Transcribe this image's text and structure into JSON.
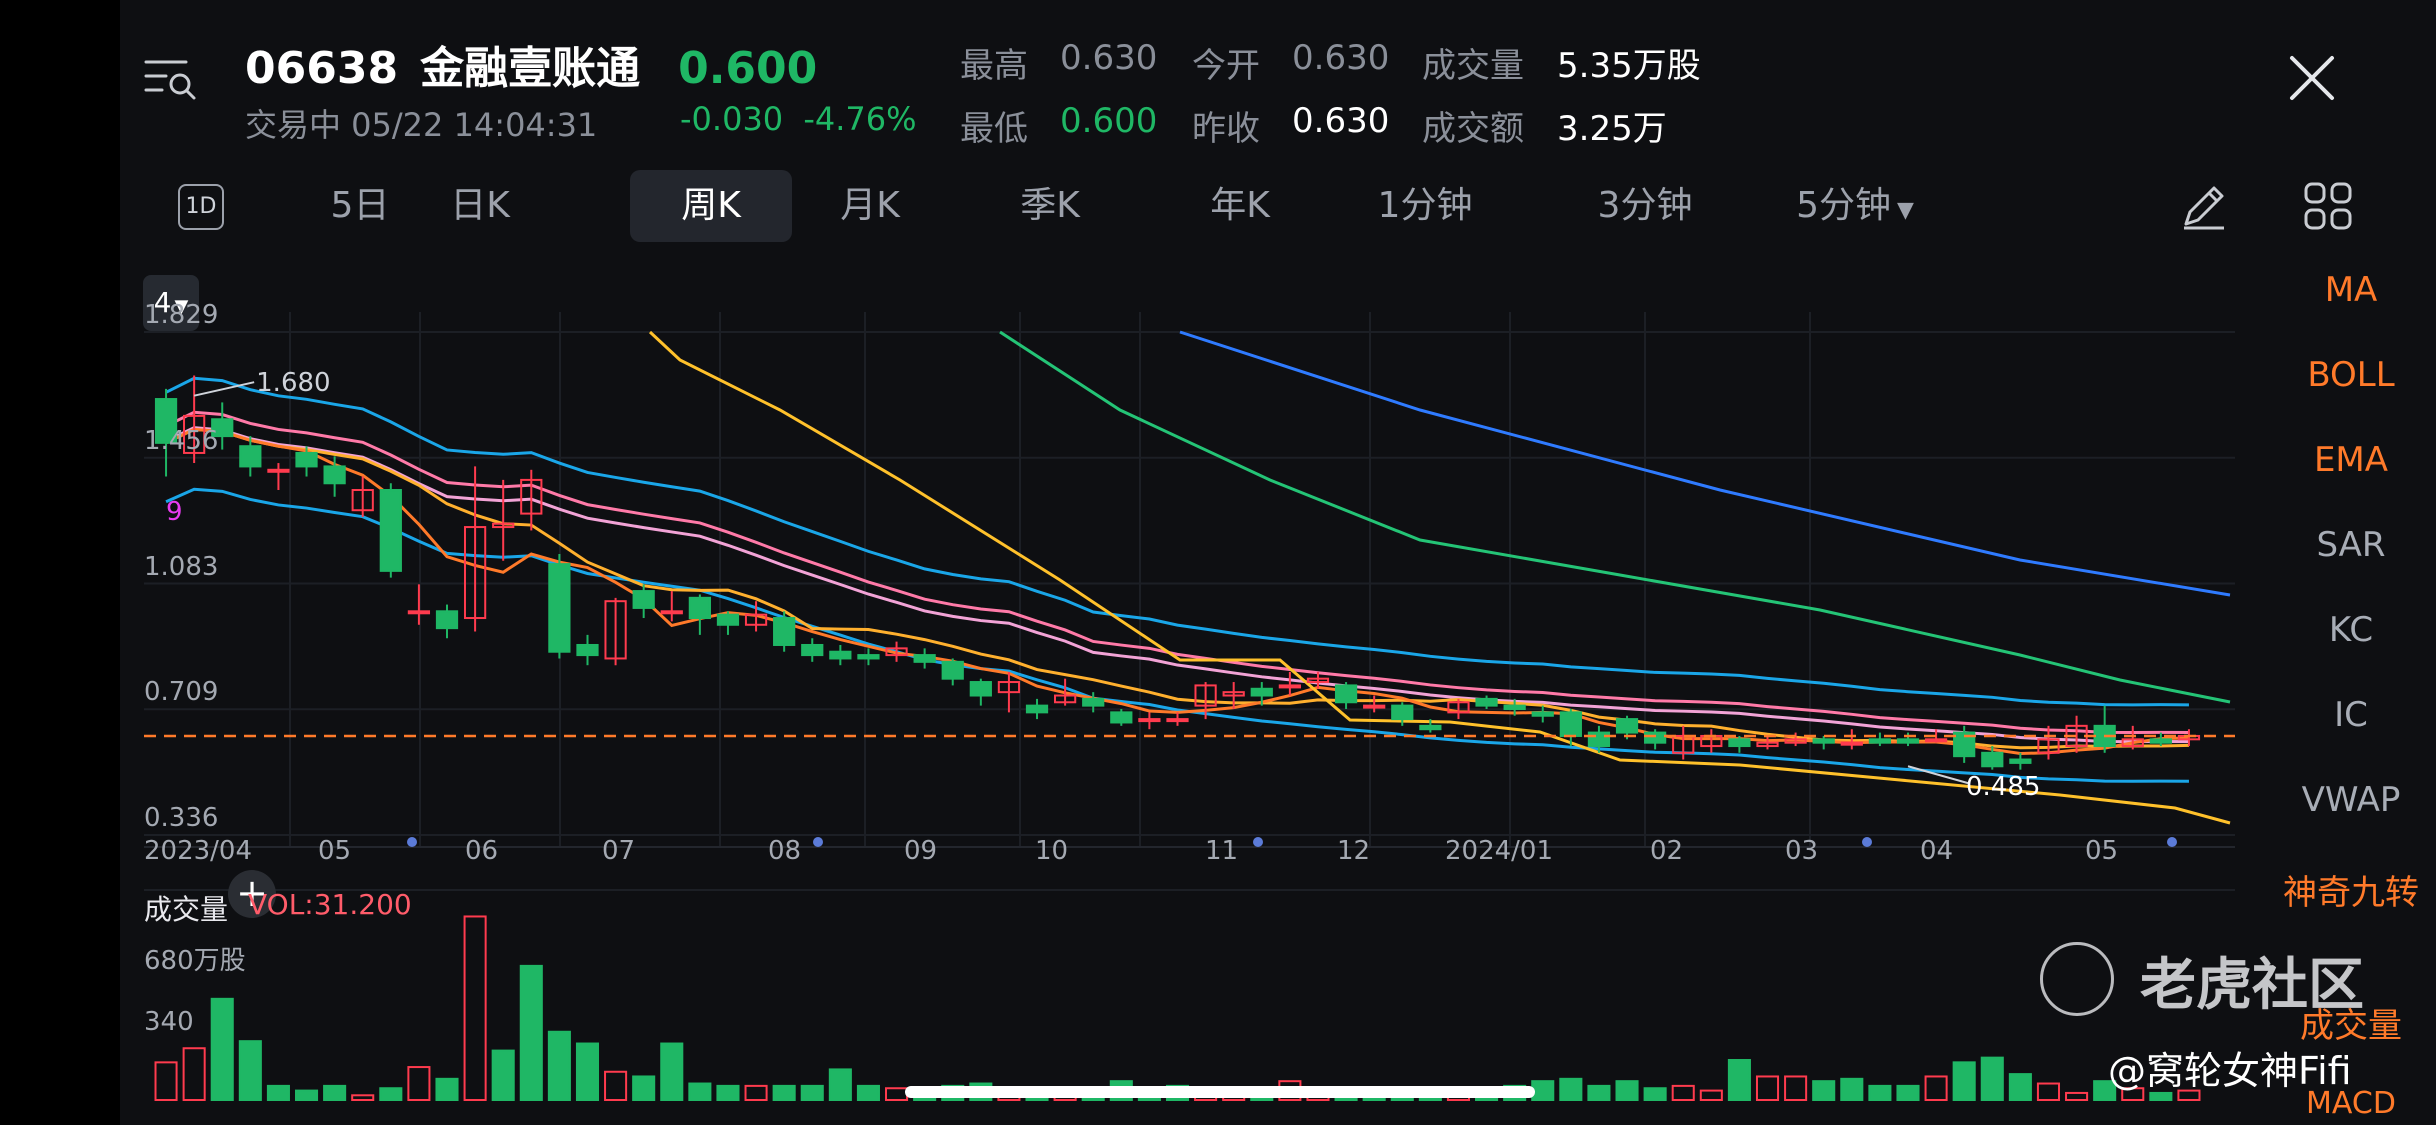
{
  "header": {
    "symbol": "06638",
    "name": "金融壹账通",
    "price": "0.600",
    "status": "交易中 05/22 14:04:31",
    "change": "-0.030",
    "change_pct": "-4.76%",
    "stats": {
      "high_label": "最高",
      "high": "0.630",
      "open_label": "今开",
      "open": "0.630",
      "volume_label": "成交量",
      "volume": "5.35万股",
      "low_label": "最低",
      "low": "0.600",
      "prev_close_label": "昨收",
      "prev_close": "0.630",
      "turnover_label": "成交额",
      "turnover": "3.25万"
    }
  },
  "tabs": {
    "d1": "1D",
    "items": [
      "5日",
      "日K",
      "周K",
      "月K",
      "季K",
      "年K",
      "1分钟",
      "3分钟",
      "5分钟"
    ],
    "active": "周K"
  },
  "indicators": [
    "MA",
    "BOLL",
    "EMA",
    "SAR",
    "KC",
    "IC",
    "VWAP",
    "神奇九转",
    "成交量",
    "MACD"
  ],
  "chart": {
    "ma_selector": "4",
    "y_ticks": [
      "1.829",
      "1.456",
      "1.083",
      "0.709",
      "0.336"
    ],
    "x_ticks": [
      "2023/04",
      "05",
      "06",
      "07",
      "08",
      "09",
      "10",
      "11",
      "12",
      "2024/01",
      "02",
      "03",
      "04",
      "05"
    ],
    "max_label": "1.680",
    "min_label": "0.485",
    "nine_label": "9",
    "last_price_line": 0.63
  },
  "volume": {
    "title": "成交量",
    "value": "VOL:31.200",
    "y_ticks": [
      "680万股",
      "340"
    ]
  },
  "colors": {
    "up": "#ff3b4e",
    "down": "#1fb765",
    "accent": "#ff7a2a"
  },
  "watermark": "老虎社区",
  "author": "@窝轮女神Fifi",
  "chart_data": {
    "type": "candlestick",
    "x": [
      "2023/04",
      "",
      "",
      "",
      "",
      "05",
      "",
      "",
      "",
      "06",
      "",
      "",
      "",
      "",
      "07",
      "",
      "",
      "",
      "08",
      "",
      "",
      "",
      "",
      "09",
      "",
      "",
      "",
      "10",
      "",
      "",
      "",
      "",
      "11",
      "",
      "",
      "",
      "12",
      "",
      "",
      "",
      "2024/01",
      "",
      "",
      "",
      "",
      "02",
      "",
      "",
      "",
      "03",
      "",
      "",
      "",
      "",
      "04",
      "",
      "",
      "",
      "05",
      "",
      "",
      ""
    ],
    "series": [
      {
        "name": "",
        "values": []
      }
    ],
    "candles": [
      [
        1.63,
        1.5,
        1.66,
        1.4
      ],
      [
        1.47,
        1.58,
        1.7,
        1.44
      ],
      [
        1.57,
        1.52,
        1.62,
        1.48
      ],
      [
        1.49,
        1.43,
        1.52,
        1.4
      ],
      [
        1.42,
        1.42,
        1.44,
        1.36
      ],
      [
        1.47,
        1.43,
        1.49,
        1.4
      ],
      [
        1.43,
        1.38,
        1.46,
        1.34
      ],
      [
        1.3,
        1.36,
        1.4,
        1.28
      ],
      [
        1.36,
        1.12,
        1.38,
        1.1
      ],
      [
        1.0,
        1.0,
        1.08,
        0.96
      ],
      [
        1.0,
        0.95,
        1.02,
        0.92
      ],
      [
        0.98,
        1.25,
        1.43,
        0.94
      ],
      [
        1.25,
        1.26,
        1.39,
        1.15
      ],
      [
        1.29,
        1.39,
        1.42,
        1.24
      ],
      [
        1.14,
        0.88,
        1.17,
        0.86
      ],
      [
        0.9,
        0.87,
        0.93,
        0.84
      ],
      [
        0.86,
        1.03,
        1.04,
        0.84
      ],
      [
        1.06,
        1.01,
        1.08,
        0.98
      ],
      [
        1.0,
        1.0,
        1.06,
        0.97
      ],
      [
        1.04,
        0.98,
        1.05,
        0.93
      ],
      [
        0.99,
        0.96,
        1.0,
        0.93
      ],
      [
        0.96,
        0.99,
        1.03,
        0.94
      ],
      [
        0.98,
        0.9,
        1.0,
        0.88
      ],
      [
        0.9,
        0.87,
        0.92,
        0.85
      ],
      [
        0.88,
        0.86,
        0.9,
        0.84
      ],
      [
        0.87,
        0.86,
        0.89,
        0.84
      ],
      [
        0.87,
        0.89,
        0.91,
        0.85
      ],
      [
        0.87,
        0.85,
        0.89,
        0.83
      ],
      [
        0.85,
        0.8,
        0.86,
        0.78
      ],
      [
        0.79,
        0.75,
        0.8,
        0.72
      ],
      [
        0.76,
        0.79,
        0.82,
        0.7
      ],
      [
        0.72,
        0.7,
        0.74,
        0.68
      ],
      [
        0.73,
        0.75,
        0.8,
        0.72
      ],
      [
        0.74,
        0.72,
        0.76,
        0.7
      ],
      [
        0.7,
        0.67,
        0.71,
        0.66
      ],
      [
        0.68,
        0.68,
        0.7,
        0.65
      ],
      [
        0.68,
        0.68,
        0.7,
        0.66
      ],
      [
        0.72,
        0.78,
        0.79,
        0.68
      ],
      [
        0.75,
        0.76,
        0.79,
        0.71
      ],
      [
        0.77,
        0.75,
        0.79,
        0.72
      ],
      [
        0.78,
        0.78,
        0.82,
        0.75
      ],
      [
        0.79,
        0.8,
        0.82,
        0.77
      ],
      [
        0.78,
        0.73,
        0.79,
        0.71
      ],
      [
        0.72,
        0.72,
        0.75,
        0.7
      ],
      [
        0.72,
        0.68,
        0.73,
        0.66
      ],
      [
        0.66,
        0.65,
        0.68,
        0.64
      ],
      [
        0.7,
        0.73,
        0.74,
        0.68
      ],
      [
        0.74,
        0.72,
        0.75,
        0.71
      ],
      [
        0.72,
        0.71,
        0.74,
        0.69
      ],
      [
        0.7,
        0.69,
        0.72,
        0.67
      ],
      [
        0.7,
        0.63,
        0.71,
        0.6
      ],
      [
        0.64,
        0.6,
        0.66,
        0.58
      ],
      [
        0.68,
        0.64,
        0.69,
        0.62
      ],
      [
        0.64,
        0.61,
        0.65,
        0.59
      ],
      [
        0.58,
        0.63,
        0.66,
        0.56
      ],
      [
        0.6,
        0.63,
        0.65,
        0.58
      ],
      [
        0.62,
        0.6,
        0.63,
        0.58
      ],
      [
        0.6,
        0.61,
        0.63,
        0.59
      ],
      [
        0.61,
        0.62,
        0.64,
        0.6
      ],
      [
        0.62,
        0.61,
        0.63,
        0.59
      ],
      [
        0.61,
        0.61,
        0.65,
        0.59
      ],
      [
        0.62,
        0.61,
        0.64,
        0.6
      ],
      [
        0.62,
        0.61,
        0.64,
        0.6
      ],
      [
        0.62,
        0.62,
        0.65,
        0.61
      ],
      [
        0.64,
        0.57,
        0.66,
        0.55
      ],
      [
        0.58,
        0.54,
        0.6,
        0.53
      ],
      [
        0.56,
        0.55,
        0.58,
        0.53
      ],
      [
        0.58,
        0.62,
        0.66,
        0.56
      ],
      [
        0.6,
        0.66,
        0.69,
        0.58
      ],
      [
        0.66,
        0.6,
        0.72,
        0.58
      ],
      [
        0.6,
        0.62,
        0.66,
        0.59
      ],
      [
        0.62,
        0.61,
        0.64,
        0.6
      ],
      [
        0.62,
        0.63,
        0.65,
        0.6
      ]
    ],
    "volumes": [
      1.6,
      2.2,
      4.3,
      2.5,
      0.6,
      0.4,
      0.6,
      0.2,
      0.5,
      1.4,
      0.9,
      7.8,
      2.1,
      5.7,
      2.9,
      2.4,
      1.2,
      1.0,
      2.4,
      0.7,
      0.6,
      0.6,
      0.6,
      0.6,
      1.3,
      0.6,
      0.5,
      0.4,
      0.6,
      0.7,
      0.5,
      0.4,
      0.5,
      0.5,
      0.8,
      0.4,
      0.6,
      0.5,
      0.5,
      0.5,
      0.8,
      0.4,
      0.5,
      0.5,
      0.4,
      0.5,
      0.4,
      0.4,
      0.6,
      0.8,
      0.9,
      0.6,
      0.8,
      0.5,
      0.6,
      0.4,
      1.7,
      1.0,
      1.0,
      0.8,
      0.9,
      0.6,
      0.6,
      1.0,
      1.6,
      1.8,
      1.1,
      0.7,
      0.3,
      0.8,
      0.5,
      0.3,
      0.4
    ],
    "volume_up": [
      true,
      true,
      false,
      false,
      false,
      false,
      false,
      true,
      false,
      true,
      false,
      true,
      false,
      false,
      false,
      false,
      true,
      false,
      false,
      false,
      false,
      true,
      false,
      false,
      false,
      false,
      true,
      false,
      false,
      false,
      true,
      false,
      true,
      false,
      false,
      false,
      false,
      true,
      true,
      false,
      true,
      true,
      false,
      false,
      false,
      false,
      true,
      false,
      false,
      false,
      false,
      false,
      false,
      false,
      true,
      true,
      false,
      true,
      true,
      false,
      false,
      false,
      false,
      true,
      false,
      false,
      false,
      true,
      true,
      false,
      true,
      false,
      true
    ],
    "ylim": [
      0.336,
      1.829
    ],
    "vol_ylim": [
      0,
      6.8
    ]
  }
}
